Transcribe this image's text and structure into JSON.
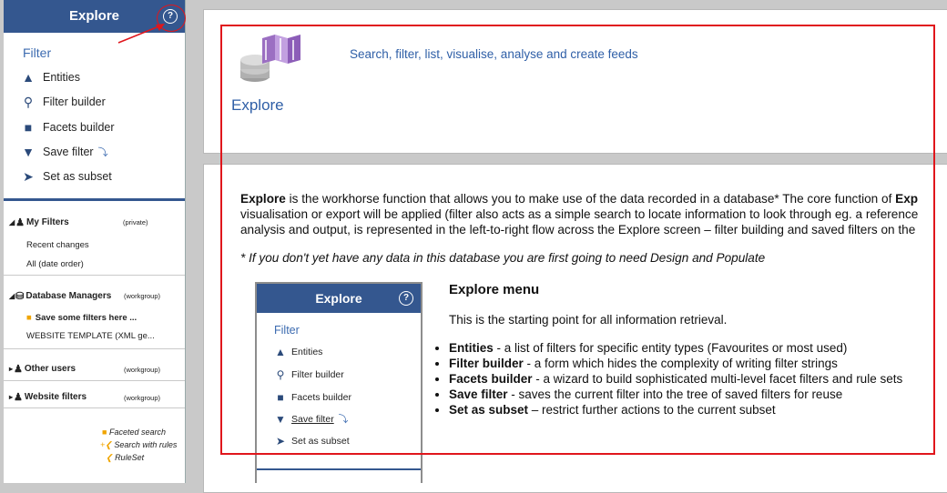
{
  "sidebar": {
    "title": "Explore",
    "help_icon": "?",
    "filter_label": "Filter",
    "items": [
      {
        "label": "Entities",
        "icon": "compass-icon"
      },
      {
        "label": "Filter builder",
        "icon": "magnify-plus-icon"
      },
      {
        "label": "Facets builder",
        "icon": "cube-icon"
      },
      {
        "label": "Save filter",
        "icon": "funnel-plus-icon"
      },
      {
        "label": "Set as subset",
        "icon": "lightning-icon"
      }
    ],
    "groups": [
      {
        "label": "My Filters",
        "scope": "(private)",
        "children": [
          "Recent changes",
          "All (date order)"
        ]
      },
      {
        "label": "Database Managers",
        "scope": "(workgroup)",
        "children": [
          "Save some filters here ...",
          "WEBSITE TEMPLATE (XML ge..."
        ]
      },
      {
        "label": "Other users",
        "scope": "(workgroup)",
        "children": []
      },
      {
        "label": "Website filters",
        "scope": "(workgroup)",
        "children": []
      }
    ],
    "footer_links": [
      "Faceted search",
      "Search with rules",
      "RuleSet"
    ]
  },
  "main": {
    "tagline": "Search, filter, list, visualise, analyse and create feeds",
    "heading": "Explore",
    "para_line1_bold": "Explore",
    "para_line1_rest": " is the workhorse function that allows you to make use of the data recorded in a database* The core function of ",
    "para_line1_trail": "Exp",
    "para_line2": "visualisation or export will be applied (filter also acts as a simple search to locate information to look through eg. a reference",
    "para_line3": "analysis and output, is represented in the left-to-right flow across the Explore screen – filter building and saved filters on the",
    "note": "* If you don't yet have any data in this database you are first going to need Design and Populate",
    "menu_title": "Explore menu",
    "menu_intro": "This is the starting point for all information retrieval.",
    "features": [
      {
        "name": "Entities",
        "desc": " - a list of filters for specific entity types (Favourites or most used)"
      },
      {
        "name": "Filter builder",
        "desc": " - a form which hides the complexity of writing filter strings"
      },
      {
        "name": "Facets builder",
        "desc": " - a wizard to build sophisticated multi-level facet filters and rule sets"
      },
      {
        "name": "Save filter",
        "desc": " - saves the current filter into the tree of saved filters for reuse"
      },
      {
        "name": "Set as subset",
        "desc": " – restrict further actions to the current subset"
      }
    ]
  },
  "mini_menu": {
    "title": "Explore",
    "filter_label": "Filter",
    "items": [
      "Entities",
      "Filter builder",
      "Facets builder",
      "Save filter",
      "Set as subset"
    ]
  },
  "colors": {
    "header": "#34578f",
    "link": "#2f5fa7",
    "annotation": "#e0161c"
  }
}
